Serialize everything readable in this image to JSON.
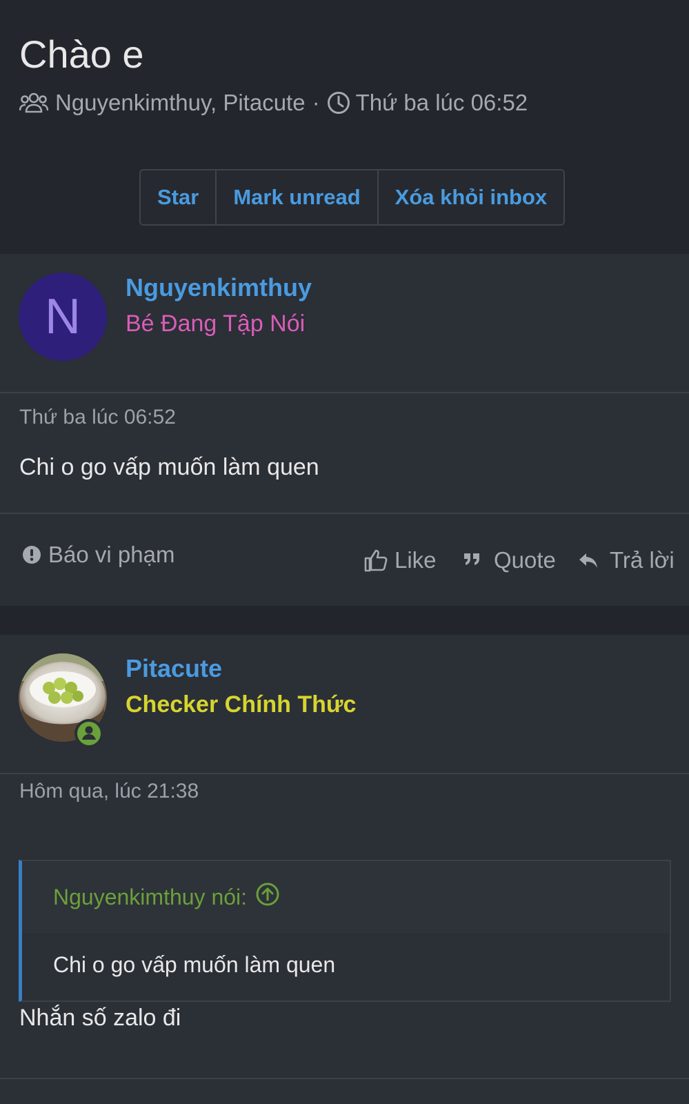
{
  "conversation": {
    "title": "Chào e",
    "participants": "Nguyenkimthuy, Pitacute",
    "separator": "·",
    "time": "Thứ ba lúc 06:52",
    "buttons": [
      "Star",
      "Mark unread",
      "Xóa khỏi inbox"
    ]
  },
  "messages": [
    {
      "author": "Nguyenkimthuy",
      "avatar_letter": "N",
      "user_title": "Bé Đang Tập Nói",
      "time": "Thứ ba lúc 06:52",
      "text": "Chi o go vấp muốn làm quen",
      "actions": {
        "report": "Báo vi phạm",
        "like": "Like",
        "quote": "Quote",
        "reply": "Trả lời"
      }
    },
    {
      "author": "Pitacute",
      "user_title": "Checker Chính Thức",
      "time": "Hôm qua, lúc 21:38",
      "quote": {
        "attribution": "Nguyenkimthuy nói:",
        "text": "Chi o go vấp muốn làm quen"
      },
      "text": "Nhắn số zalo đi"
    }
  ],
  "colors": {
    "link": "#4a9be0",
    "title_pink": "#d95db8",
    "title_yellow": "#d6d52f",
    "quote_green": "#6aa13a",
    "online_green": "#6aa13a",
    "avatar_bg": "#2e1f7a"
  },
  "icons": {
    "participants": "users-icon",
    "time": "clock-icon",
    "report": "exclamation-circle-icon",
    "like": "thumbs-up-icon",
    "quote": "quote-icon",
    "reply": "reply-icon",
    "quote_jump": "arrow-up-circle-icon",
    "online": "user-online-icon"
  }
}
